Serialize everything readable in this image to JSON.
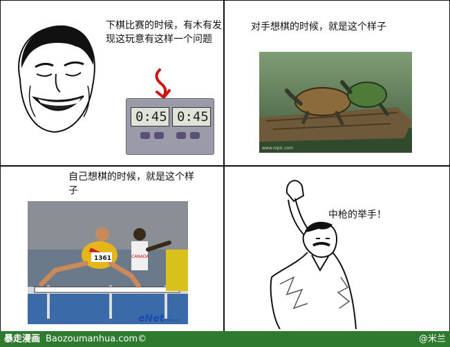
{
  "panels": [
    {
      "caption": "下棋比赛的时候，有木有发现这玩意有这样一个问题",
      "clock_left": "0:45",
      "clock_right": "0:45"
    },
    {
      "caption": "对手想棋的时候，就是这个样子",
      "watermark": "www.nipic.com"
    },
    {
      "caption": "自己想棋的时候，就是这个样子",
      "bib": "1361",
      "flag": "CANADA",
      "logo": "eNet",
      "logo_sub": ".com.cn"
    },
    {
      "caption": "中枪的举手！"
    }
  ],
  "footer": {
    "brand": "暴走漫画",
    "site": "Baozoumanhua.com©",
    "author": "@米兰"
  }
}
